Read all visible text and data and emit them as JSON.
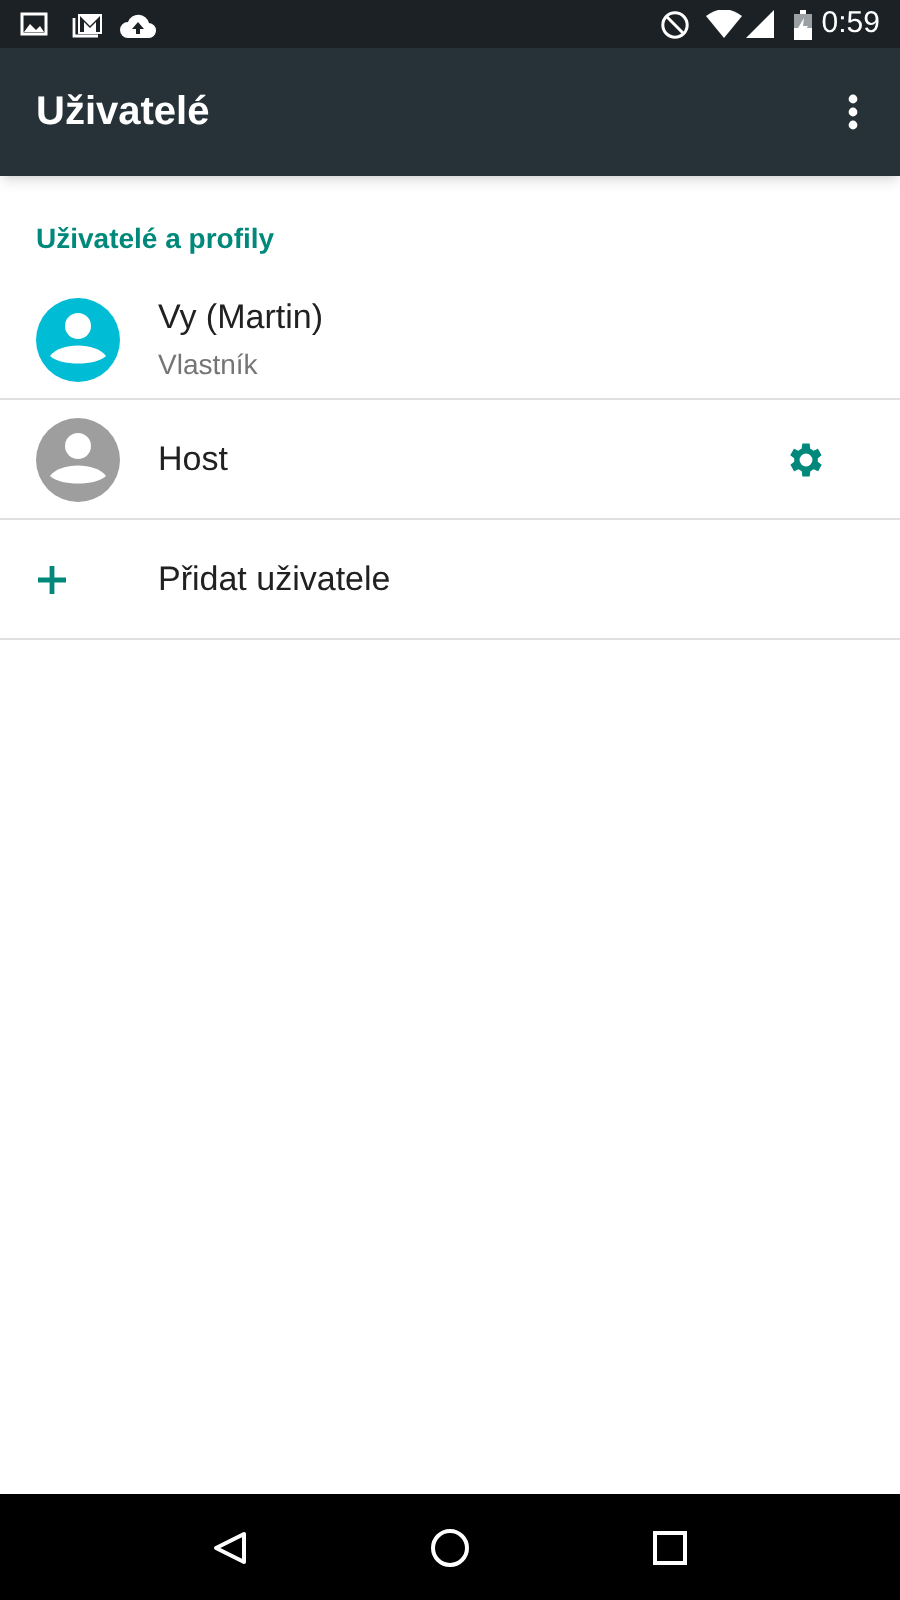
{
  "status_bar": {
    "time": "0:59"
  },
  "app_bar": {
    "title": "Uživatelé"
  },
  "section": {
    "title": "Uživatelé a profily"
  },
  "items": [
    {
      "kind": "user",
      "name": "Vy (Martin)",
      "subtitle": "Vlastník",
      "color": "#00bcd4"
    },
    {
      "kind": "guest",
      "name": "Host",
      "color": "#9e9e9e"
    },
    {
      "kind": "add",
      "name": "Přidat uživatele"
    }
  ]
}
